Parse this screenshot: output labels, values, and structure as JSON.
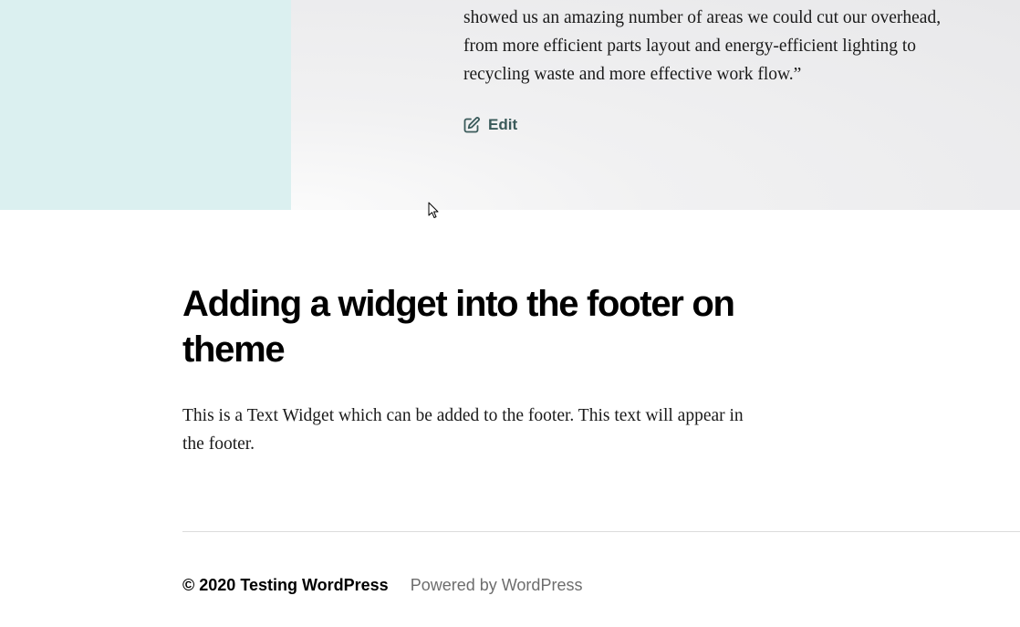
{
  "post": {
    "quote_lines": [
      "showed us an amazing number of areas we could cut our overhead,",
      "from more efficient parts layout and energy-efficient lighting to",
      "recycling waste and more effective work flow.”"
    ],
    "edit_label": "Edit",
    "edit_icon": "edit-icon"
  },
  "widget": {
    "title": "Adding a widget into the footer on theme",
    "text": "This is a Text Widget which can be added to the footer.  This text will appear in the footer."
  },
  "footer": {
    "copyright_symbol_year": "© 2020",
    "site_name": "Testing WordPress",
    "powered_by": "Powered by WordPress"
  },
  "colors": {
    "teal_block": "#dbf0f0",
    "edit_link": "#3a5a5a",
    "muted_text": "#6d6d6d"
  }
}
